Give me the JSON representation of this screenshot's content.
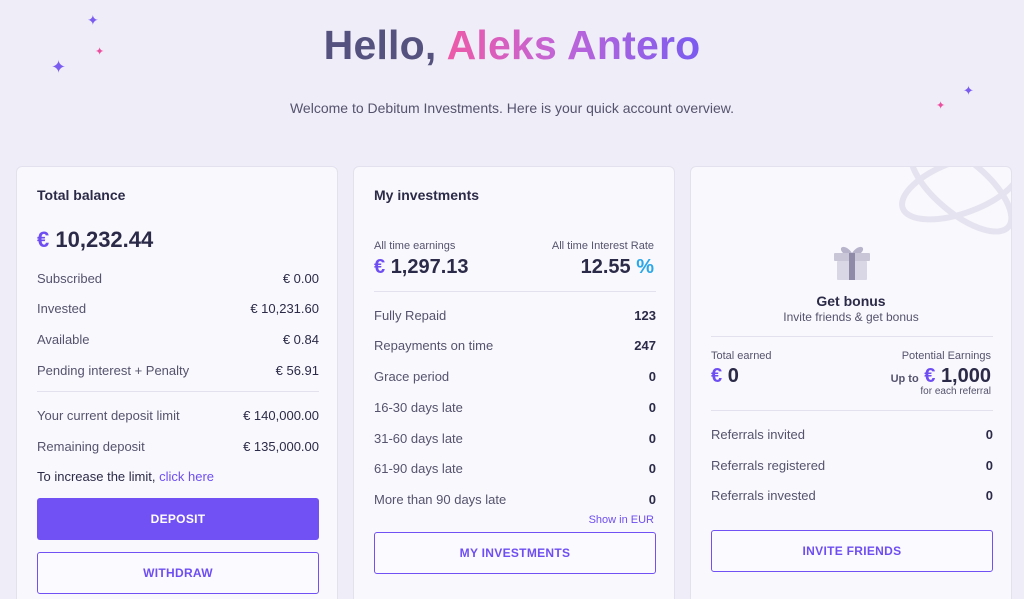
{
  "hero": {
    "greeting": "Hello,",
    "name": "Aleks Antero",
    "subtitle": "Welcome to Debitum Investments. Here is your quick account overview."
  },
  "balance_card": {
    "title": "Total balance",
    "currency": "€",
    "total": "10,232.44",
    "rows": [
      {
        "label": "Subscribed",
        "value": "€ 0.00"
      },
      {
        "label": "Invested",
        "value": "€ 10,231.60"
      },
      {
        "label": "Available",
        "value": "€ 0.84"
      },
      {
        "label": "Pending interest + Penalty",
        "value": "€ 56.91"
      }
    ],
    "limit_rows": [
      {
        "label": "Your current deposit limit",
        "value": "€ 140,000.00"
      },
      {
        "label": "Remaining deposit",
        "value": "€ 135,000.00"
      }
    ],
    "limit_note": "To increase the limit,",
    "limit_link": "click here",
    "deposit_label": "DEPOSIT",
    "withdraw_label": "WITHDRAW"
  },
  "investments_card": {
    "title": "My investments",
    "earnings_label": "All time earnings",
    "earnings_currency": "€",
    "earnings_value": "1,297.13",
    "rate_label": "All time Interest Rate",
    "rate_value": "12.55",
    "rate_unit": "%",
    "rows": [
      {
        "label": "Fully Repaid",
        "value": "123"
      },
      {
        "label": "Repayments on time",
        "value": "247"
      },
      {
        "label": "Grace period",
        "value": "0"
      },
      {
        "label": "16-30 days late",
        "value": "0"
      },
      {
        "label": "31-60 days late",
        "value": "0"
      },
      {
        "label": "61-90 days late",
        "value": "0"
      },
      {
        "label": "More than 90 days late",
        "value": "0"
      }
    ],
    "show_eur": "Show in EUR",
    "button_label": "MY INVESTMENTS"
  },
  "bonus_card": {
    "title": "Get bonus",
    "subtitle": "Invite friends & get bonus",
    "total_earned_label": "Total earned",
    "total_earned_currency": "€",
    "total_earned_value": "0",
    "potential_label": "Potential Earnings",
    "upto": "Up to",
    "potential_currency": "€",
    "potential_value": "1,000",
    "for_each": "for each referral",
    "rows": [
      {
        "label": "Referrals invited",
        "value": "0"
      },
      {
        "label": "Referrals registered",
        "value": "0"
      },
      {
        "label": "Referrals invested",
        "value": "0"
      }
    ],
    "button_label": "INVITE FRIENDS"
  },
  "colors": {
    "accent": "#7151f4",
    "pink": "#ec4fa0",
    "percent": "#2aa7e8",
    "background": "#efedf7"
  }
}
